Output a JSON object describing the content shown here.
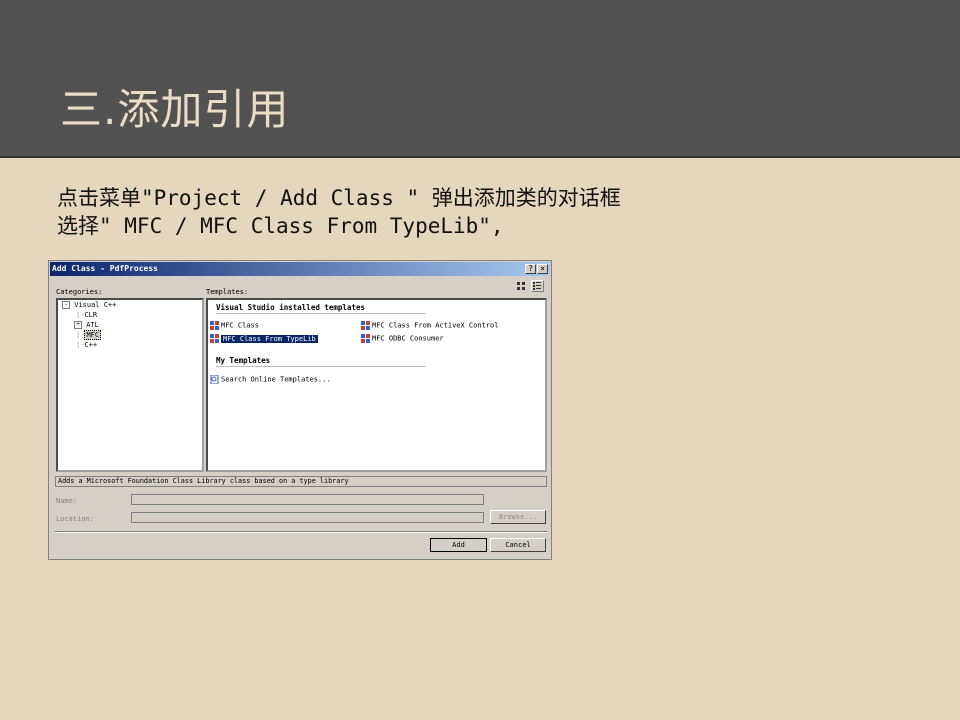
{
  "slide": {
    "title": "三.添加引用",
    "line1": "点击菜单\"Project / Add Class \" 弹出添加类的对话框",
    "line2": "选择\" MFC / MFC Class From TypeLib\","
  },
  "dialog": {
    "title": "Add Class - PdfProcess",
    "help_btn": "?",
    "close_btn": "×",
    "categories_label": "Categories:",
    "templates_label": "Templates:",
    "tree": [
      "Visual C++",
      "CLR",
      "ATL",
      "MFC",
      "C++"
    ],
    "section_installed": "Visual Studio installed templates",
    "templates": [
      "MFC Class",
      "MFC Class From ActiveX Control",
      "MFC Class From TypeLib",
      "MFC ODBC Consumer"
    ],
    "section_my": "My Templates",
    "search_online": "Search Online Templates...",
    "description": "Adds a Microsoft Foundation Class Library class based on a type library",
    "name_label": "Name:",
    "location_label": "Location:",
    "browse_btn": "Browse...",
    "add_btn": "Add",
    "cancel_btn": "Cancel"
  },
  "colors": {
    "header_bg": "#525252",
    "slide_bg": "#e6d6bd",
    "title_color": "#eadcc6",
    "titlebar": "#0a246a"
  }
}
